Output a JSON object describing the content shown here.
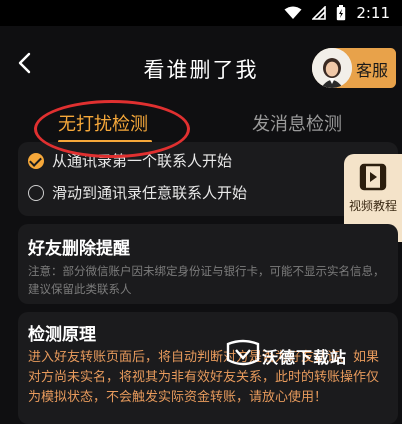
{
  "status_bar": {
    "time": "2:11",
    "icons": [
      "wifi-icon",
      "signal-icon",
      "battery-icon"
    ]
  },
  "header": {
    "title": "看谁删了我",
    "back_icon": "chevron-left-icon",
    "customer_service_label": "客服"
  },
  "tabs": [
    {
      "label": "无打扰检测",
      "active": true
    },
    {
      "label": "发消息检测",
      "active": false
    }
  ],
  "options": [
    {
      "label": "从通讯录第一个联系人开始",
      "selected": true
    },
    {
      "label": "滑动到通讯录任意联系人开始",
      "selected": false
    }
  ],
  "video_tutorial": {
    "label": "视频教程",
    "icon": "film-icon"
  },
  "friend_deletion_reminder": {
    "title": "好友删除提醒",
    "note": "注意：部分微信账户因未绑定身份证与银行卡，可能不显示实名信息，建议保留此类联系人"
  },
  "detection_principle": {
    "title": "检测原理",
    "text": "进入好友转账页面后，将自动判断对方是否为好友认证。如果对方尚未实名，将视其为非有效好友关系，此时的转账操作仅为模拟状态，不会触发实际资金转账，请放心使用！"
  },
  "watermark": "沃德下载站",
  "colors": {
    "accent": "#f6a83a",
    "annotation_circle": "#e03030",
    "card_background": "#1b1b1d",
    "principle_text": "#e79a5c"
  }
}
